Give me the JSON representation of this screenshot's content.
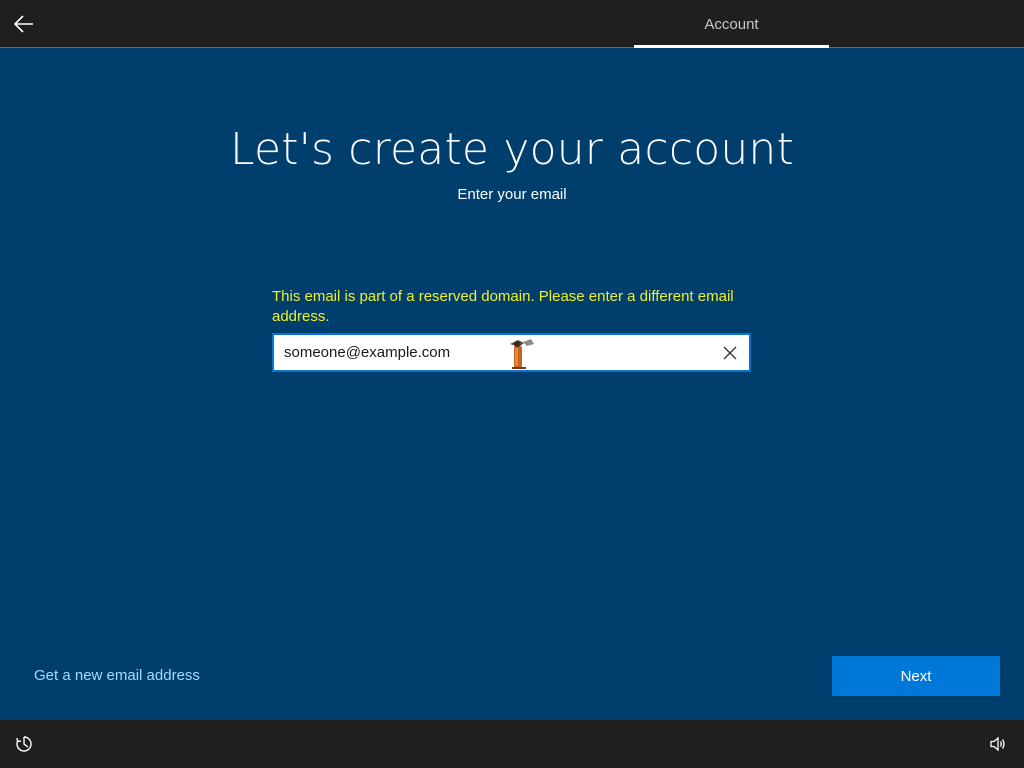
{
  "header": {
    "back_icon": "back-arrow-icon",
    "tab_label": "Account"
  },
  "main": {
    "title": "Let's create your account",
    "subtitle": "Enter your email",
    "error_message": "This email is part of a reserved domain. Please enter a different email address.",
    "email_value": "someone@example.com",
    "clear_icon": "close-icon"
  },
  "footer_actions": {
    "new_email_link": "Get a new email address",
    "next_label": "Next"
  },
  "bottom_bar": {
    "ease_of_access_icon": "ease-of-access-icon",
    "volume_icon": "volume-icon"
  },
  "colors": {
    "background": "#003e6e",
    "bar": "#1f1f1f",
    "accent": "#0078d7",
    "error": "#f0f028",
    "link": "#a6d8ff"
  }
}
